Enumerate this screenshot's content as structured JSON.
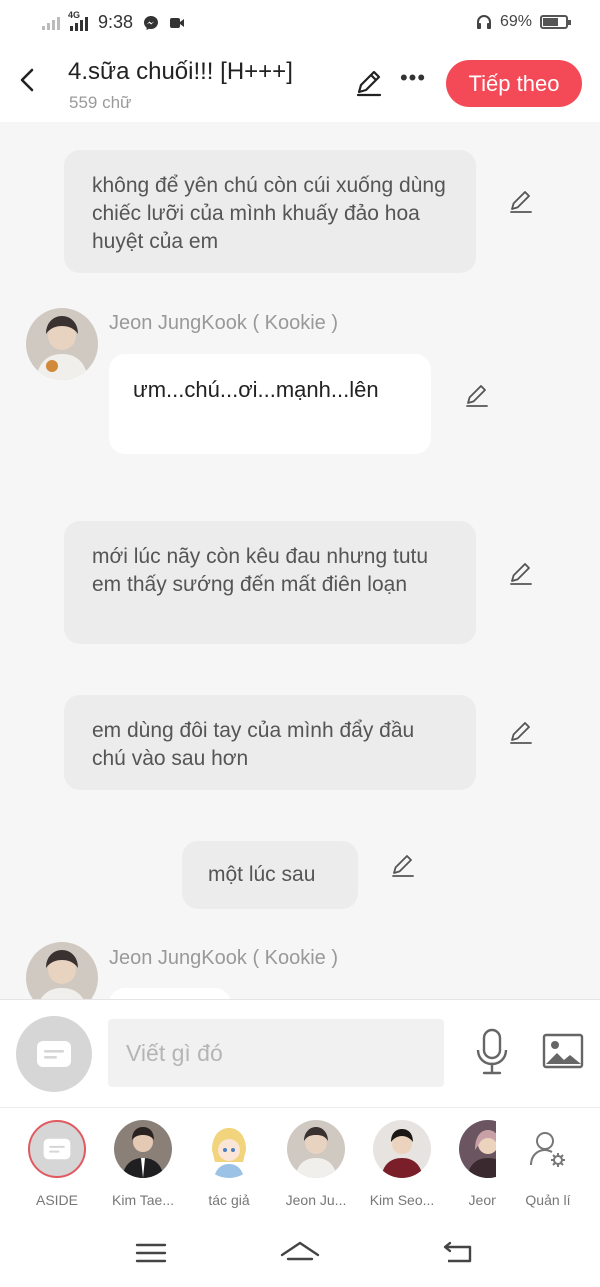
{
  "status": {
    "network": "4G",
    "time": "9:38",
    "battery": "69%",
    "battery_level": 0.69
  },
  "header": {
    "title": "4.sữa chuối!!! [H+++]",
    "word_count": "559 chữ",
    "next_label": "Tiếp theo"
  },
  "messages": [
    {
      "type": "narration",
      "text": "không để yên chú còn cúi xuống dùng chiếc lưỡi của mình khuấy đảo hoa huyệt của em"
    },
    {
      "type": "character",
      "name": "Jeon JungKook ( Kookie )",
      "text": "ưm...chú...ơi...mạnh...lên"
    },
    {
      "type": "narration",
      "text": "mới lúc nãy còn kêu đau nhưng tutu em thấy sướng đến mất điên loạn"
    },
    {
      "type": "narration",
      "text": "em dùng đôi tay của mình đẩy đầu chú vào sau hơn"
    },
    {
      "type": "narration",
      "text": "một lúc sau"
    },
    {
      "type": "character",
      "name": "Jeon JungKook ( Kookie )",
      "text": ""
    }
  ],
  "composer": {
    "placeholder": "Viết gì đó"
  },
  "characters": [
    {
      "label": "ASIDE",
      "icon": "aside-icon"
    },
    {
      "label": "Kim Tae..."
    },
    {
      "label": "tác giả"
    },
    {
      "label": "Jeon Ju..."
    },
    {
      "label": "Kim Seo..."
    },
    {
      "label": "Jeon ("
    },
    {
      "label": "Quản lí",
      "icon": "manage-users-icon"
    }
  ],
  "colors": {
    "accent": "#f44a57",
    "bubble": "#ececec",
    "background": "#f6f6f6"
  }
}
